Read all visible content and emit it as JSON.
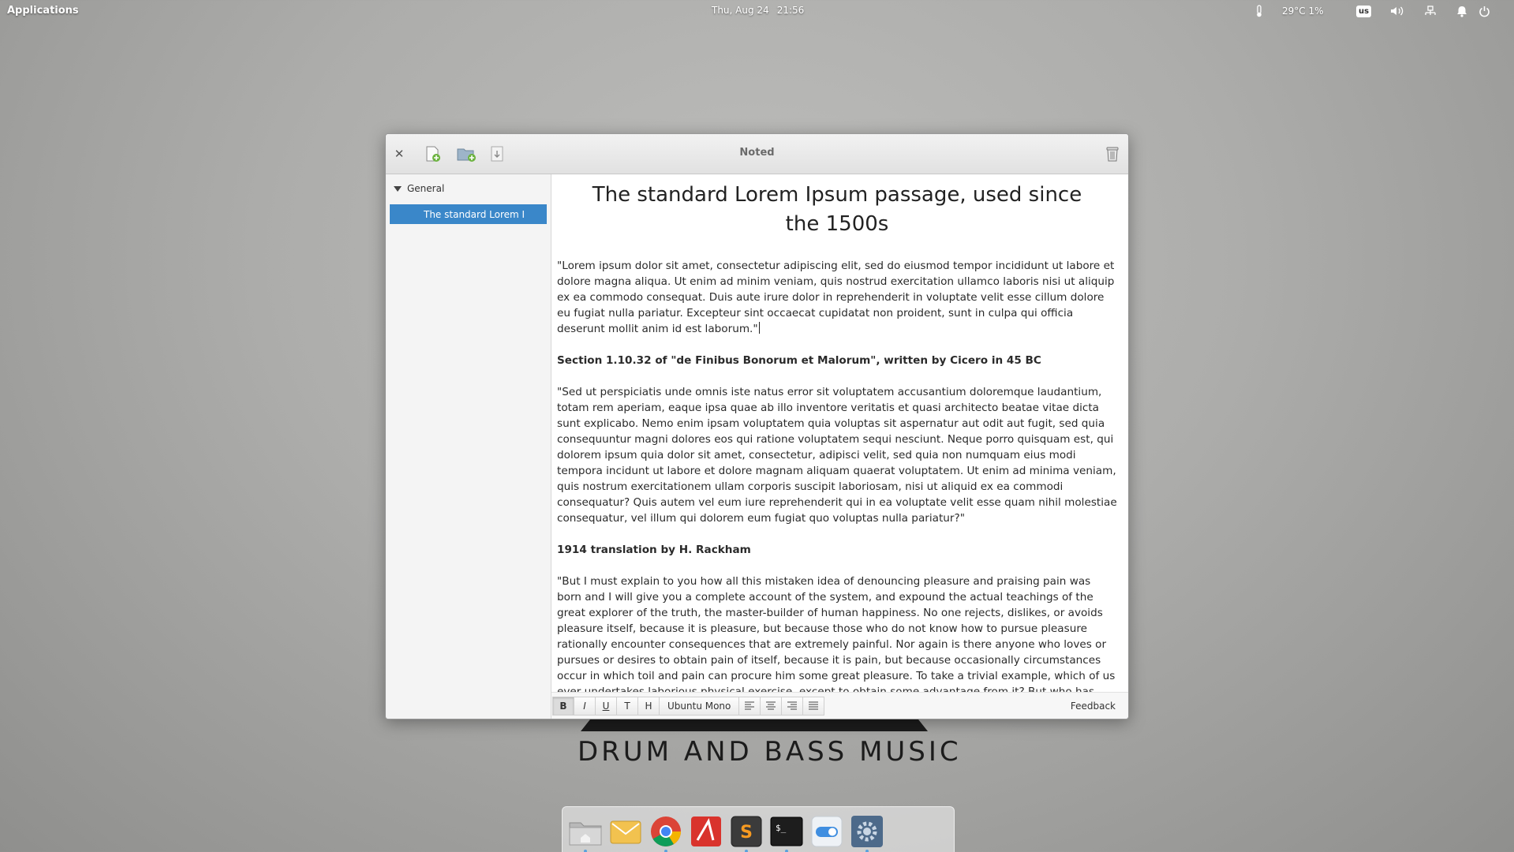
{
  "panel": {
    "applications_label": "Applications",
    "date": "Thu, Aug 24",
    "time": "21:56",
    "weather": "29°C 1%",
    "keyboard_layout": "us"
  },
  "window": {
    "title": "Noted"
  },
  "sidebar": {
    "notebook": "General",
    "selected_note": "The standard Lorem I"
  },
  "document": {
    "title": "The standard Lorem Ipsum passage, used since the 1500s",
    "p1": "\"Lorem ipsum dolor sit amet, consectetur adipiscing elit, sed do eiusmod tempor incididunt ut labore et dolore magna aliqua. Ut enim ad minim veniam, quis nostrud exercitation ullamco laboris nisi ut aliquip ex ea commodo consequat. Duis aute irure dolor in reprehenderit in voluptate velit esse cillum dolore eu fugiat nulla pariatur. Excepteur sint occaecat cupidatat non proident, sunt in culpa qui officia deserunt mollit anim id est laborum.\"",
    "h1": "Section 1.10.32 of \"de Finibus Bonorum et Malorum\", written by Cicero in 45 BC",
    "p2": "\"Sed ut perspiciatis unde omnis iste natus error sit voluptatem accusantium doloremque laudantium, totam rem aperiam, eaque ipsa quae ab illo inventore veritatis et quasi architecto beatae vitae dicta sunt explicabo. Nemo enim ipsam voluptatem quia voluptas sit aspernatur aut odit aut fugit, sed quia consequuntur magni dolores eos qui ratione voluptatem sequi nesciunt. Neque porro quisquam est, qui dolorem ipsum quia dolor sit amet, consectetur, adipisci velit, sed quia non numquam eius modi tempora incidunt ut labore et dolore magnam aliquam quaerat voluptatem. Ut enim ad minima veniam, quis nostrum exercitationem ullam corporis suscipit laboriosam, nisi ut aliquid ex ea commodi consequatur? Quis autem vel eum iure reprehenderit qui in ea voluptate velit esse quam nihil molestiae consequatur, vel illum qui dolorem eum fugiat quo voluptas nulla pariatur?\"",
    "h2": "1914 translation by H. Rackham",
    "p3": "\"But I must explain to you how all this mistaken idea of denouncing pleasure and praising pain was born and I will give you a complete account of the system, and expound the actual teachings of the great explorer of the truth, the master-builder of human happiness. No one rejects, dislikes, or avoids pleasure itself, because it is pleasure, but because those who do not know how to pursue pleasure rationally encounter consequences that are extremely painful. Nor again is there anyone who loves or pursues or desires to obtain pain of itself, because it is pain, but because occasionally circumstances occur in which toil and pain can procure him some great pleasure. To take a trivial example, which of us ever undertakes laborious physical exercise, except to obtain some advantage from it? But who has any right to find fault with a man who chooses to enjoy a pleasure that has no annoying consequences, or one who avoids a pain that produces no resultant pleasure?\""
  },
  "formatbar": {
    "bold": "B",
    "italic": "I",
    "underline": "U",
    "text": "T",
    "heading": "H",
    "font": "Ubuntu Mono",
    "feedback": "Feedback"
  },
  "wallpaper": {
    "text": "DRUM AND BASS MUSIC"
  },
  "colors": {
    "selection": "#3a87c9",
    "dock_indicator": "#5aa0dd"
  }
}
